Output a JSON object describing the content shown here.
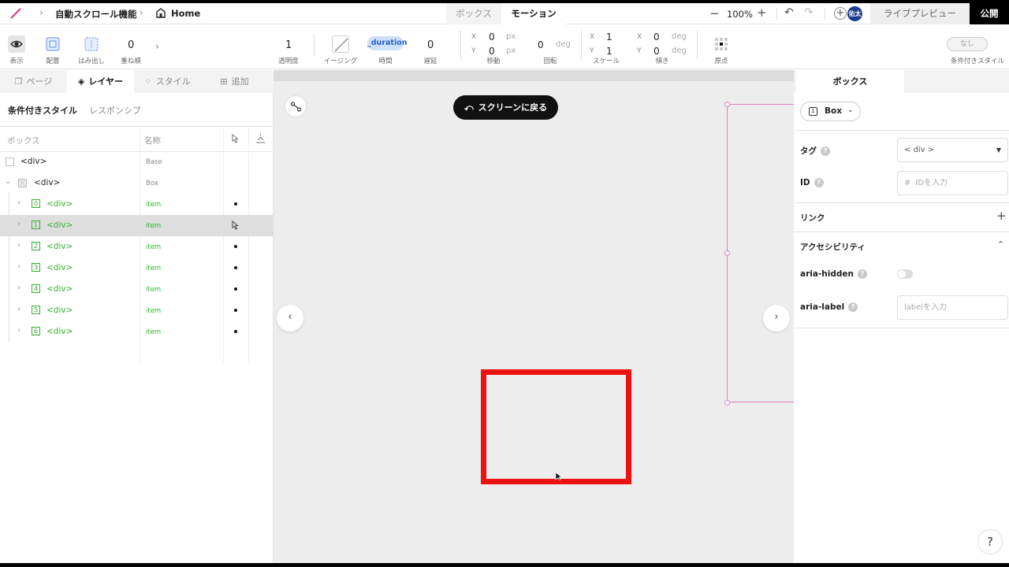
{
  "topbar": {
    "breadcrumb_project": "自動スクロール機能",
    "breadcrumb_page": "Home",
    "mode_tabs": [
      "ボックス",
      "モーション"
    ],
    "zoom": "100%",
    "avatar_text": "佑太",
    "live_preview": "ライブプレビュー",
    "publish": "公開"
  },
  "toolbar": {
    "display_label": "表示",
    "layout_label": "配置",
    "overflow_label": "はみ出し",
    "zindex_value": "0",
    "zindex_label": "重ね順",
    "opacity_value": "1",
    "opacity_label": "透明度",
    "easing_label": "イージング",
    "duration_value": "_duration",
    "duration_label": "時間",
    "delay_value": "0",
    "delay_label": "遅延",
    "move_x": "0",
    "move_y": "0",
    "move_unit": "px",
    "move_label": "移動",
    "rotate_value": "0",
    "rotate_unit": "deg",
    "rotate_label": "回転",
    "scale_x": "1",
    "scale_y": "1",
    "scale_label": "スケール",
    "skew_x": "0",
    "skew_y": "0",
    "skew_unit": "deg",
    "skew_label": "傾き",
    "origin_label": "原点",
    "conditional_value": "なし",
    "conditional_label": "条件付きスタイル",
    "x_axis": "X",
    "y_axis": "Y"
  },
  "left_panel": {
    "tabs": [
      "ページ",
      "レイヤー",
      "スタイル",
      "追加"
    ],
    "subtabs": [
      "条件付きスタイル",
      "レスポンシブ"
    ],
    "columns": [
      "ボックス",
      "名称"
    ],
    "rows": [
      {
        "tag": "<div>",
        "name": "Base"
      },
      {
        "tag": "<div>",
        "name": "Box"
      },
      {
        "index": "0",
        "tag": "<div>",
        "name": "item"
      },
      {
        "index": "1",
        "tag": "<div>",
        "name": "item"
      },
      {
        "index": "2",
        "tag": "<div>",
        "name": "item"
      },
      {
        "index": "3",
        "tag": "<div>",
        "name": "item"
      },
      {
        "index": "4",
        "tag": "<div>",
        "name": "item"
      },
      {
        "index": "5",
        "tag": "<div>",
        "name": "item"
      },
      {
        "index": "6",
        "tag": "<div>",
        "name": "item"
      }
    ]
  },
  "canvas": {
    "back_button": "スクリーンに戻る",
    "nav_prev": "‹",
    "nav_next": "›"
  },
  "right_panel": {
    "tab": "ボックス",
    "box_select": "Box",
    "box_icon": "1",
    "tag_label": "タグ",
    "tag_value": "< div >",
    "id_label": "ID",
    "id_placeholder": "IDを入力",
    "link_label": "リンク",
    "a11y_label": "アクセシビリティ",
    "aria_hidden_label": "aria-hidden",
    "aria_label_label": "aria-label",
    "aria_label_placeholder": "labelを入力",
    "help": "?"
  },
  "colors": {
    "accent_green": "#2fb32f",
    "selection_pink": "#e77bbd",
    "red_box": "#ee1111",
    "duration_blue": "#2962c9"
  }
}
